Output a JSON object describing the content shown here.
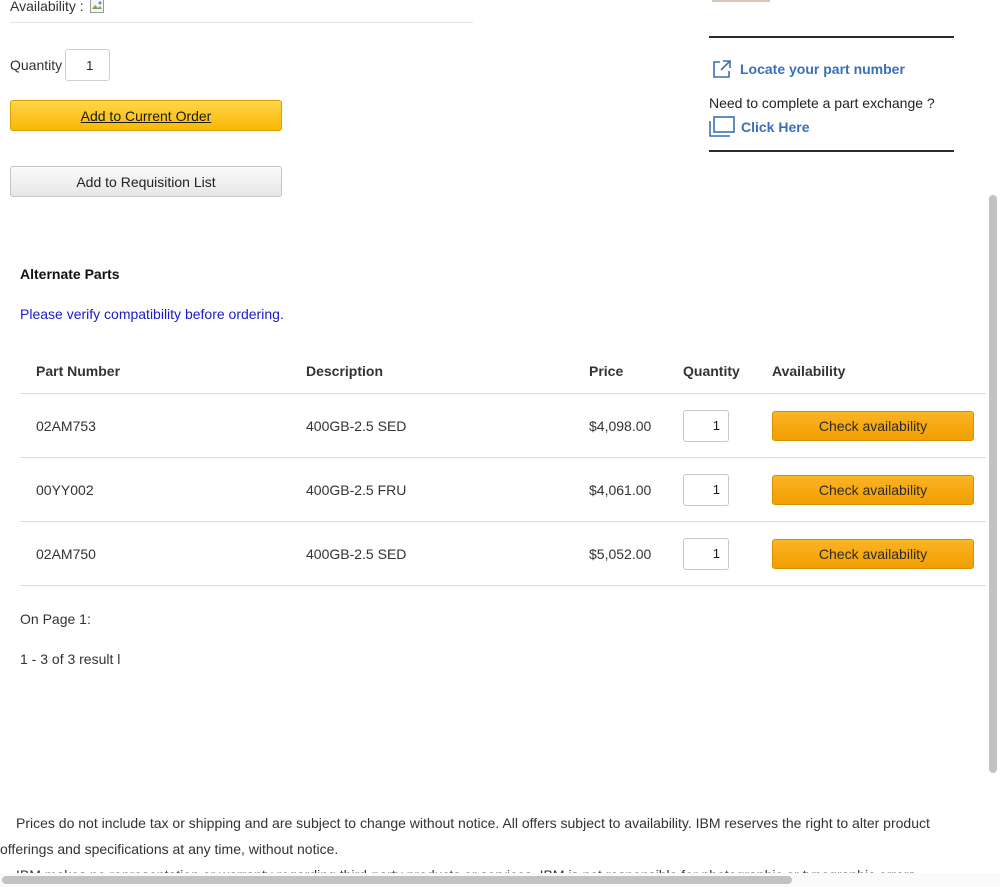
{
  "product": {
    "availability_label": "Availability :",
    "quantity_label": "Quantity",
    "quantity_value": "1",
    "add_to_order_label": "Add to Current Order",
    "add_to_requisition_label": "Add to Requisition List"
  },
  "sidebar": {
    "locate_part_label": "Locate your part number",
    "exchange_text": "Need to complete a part exchange ?",
    "click_here_label": "Click Here"
  },
  "alternate_parts": {
    "title": "Alternate Parts",
    "note": "Please verify compatibility before ordering.",
    "columns": {
      "part_number": "Part Number",
      "description": "Description",
      "price": "Price",
      "quantity": "Quantity",
      "availability": "Availability"
    },
    "rows": [
      {
        "part_number": "02AM753",
        "description": "400GB-2.5 SED",
        "price": "$4,098.00",
        "quantity": "1",
        "action": "Check availability"
      },
      {
        "part_number": "00YY002",
        "description": "400GB-2.5 FRU",
        "price": "$4,061.00",
        "quantity": "1",
        "action": "Check availability"
      },
      {
        "part_number": "02AM750",
        "description": "400GB-2.5 SED",
        "price": "$5,052.00",
        "quantity": "1",
        "action": "Check availability"
      }
    ],
    "page_label": "On Page 1:",
    "results_label": "1 - 3 of 3 result l"
  },
  "footer": {
    "disclaimer_1": "Prices do not include tax or shipping and are subject to change without notice. All offers subject to availability. IBM reserves the right to alter product offerings and specifications at any time, without notice.",
    "disclaimer_2": "IBM makes no representation or warranty regarding third-party products or services. IBM is not responsible for photographic or typographic errors."
  },
  "colors": {
    "primary_button": "#f9b902",
    "check_button": "#f19f00",
    "link_blue": "#3b6fb8",
    "note_blue": "#1a1acc"
  },
  "icons": {
    "broken_image": "broken-image-icon",
    "external_link": "external-link-icon",
    "window": "window-icon"
  }
}
